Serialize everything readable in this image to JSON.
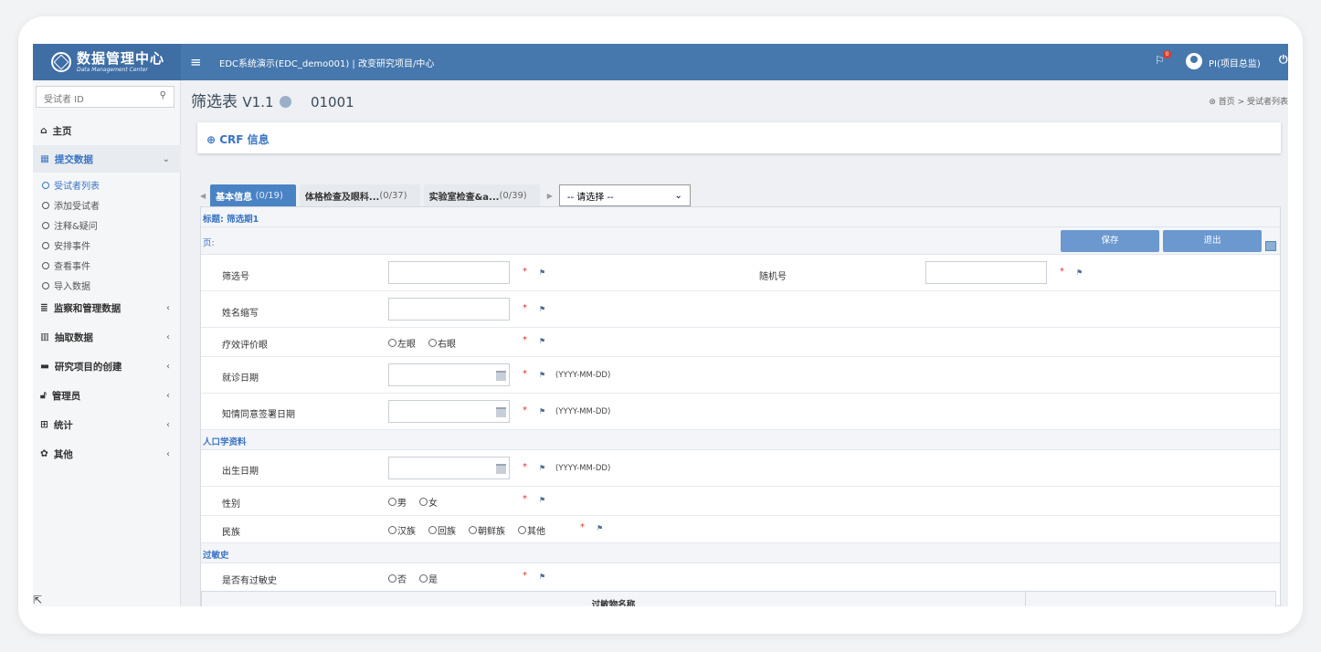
{
  "topbar": {
    "logo_cn": "数据管理中心",
    "logo_en": "Data Management Center",
    "menu_icon": "≡",
    "study_title": "EDC系统演示(EDC_demo001) | 改变研究项目/中心",
    "notification_count": "0",
    "user_name": "PI(项目总监)",
    "power_icon": "⏻"
  },
  "sidebar": {
    "search_placeholder": "受试者 ID",
    "home": "主页",
    "submit_data": "提交数据",
    "submit_sub": [
      "受试者列表",
      "添加受试者",
      "注释&疑问",
      "安排事件",
      "查看事件",
      "导入数据"
    ],
    "monitor": "监察和管理数据",
    "extract": "抽取数据",
    "study_create": "研究项目的创建",
    "admin": "管理员",
    "stats": "统计",
    "other": "其他"
  },
  "header": {
    "title": "筛选表",
    "version": "V1.1",
    "subject_code": "01001",
    "breadcrumb": "首页 > 受试者列表"
  },
  "crf_box": {
    "label": "CRF 信息"
  },
  "tabs": [
    {
      "label": "基本信息",
      "count": "(0/19)"
    },
    {
      "label": "体格检查及眼科...",
      "count": "(0/37)"
    },
    {
      "label": "实验室检查&a...",
      "count": "(0/39)"
    }
  ],
  "tab_select": {
    "value": "-- 请选择 --"
  },
  "form": {
    "title_label": "标题: 筛选期1",
    "page_label": "页:",
    "save_button": "保存",
    "exit_button": "退出",
    "screening_no": "筛选号",
    "random_no": "随机号",
    "name_abbr": "姓名缩写",
    "eval_eye": "疗效评价眼",
    "eye_options": [
      "左眼",
      "右眼"
    ],
    "visit_date": "就诊日期",
    "consent_date": "知情同意签署日期",
    "date_hint": "(YYYY-MM-DD)",
    "demo_section": "人口学资料",
    "birth_date": "出生日期",
    "gender": "性别",
    "gender_options": [
      "男",
      "女"
    ],
    "ethnicity": "民族",
    "ethnicity_options": [
      "汉族",
      "回族",
      "朝鲜族",
      "其他"
    ],
    "allergy_section": "过敏史",
    "has_allergy": "是否有过敏史",
    "allergy_options": [
      "否",
      "是"
    ],
    "allergen_name": "过敏物名称",
    "required_mark": "*",
    "flag_glyph": "⚑"
  }
}
